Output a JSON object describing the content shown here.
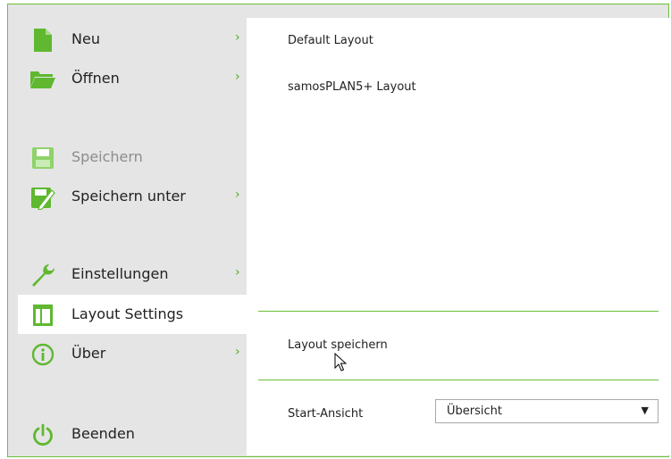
{
  "colors": {
    "accent": "#5fb830",
    "frame_border": "#6bbf3a",
    "menu_bg": "#e5e5e5",
    "disabled_icon": "#8fd36a"
  },
  "menu": [
    {
      "id": "neu",
      "label": "Neu",
      "icon": "new-document-icon",
      "submenu": true
    },
    {
      "id": "oeffnen",
      "label": "Öffnen",
      "icon": "folder-open-icon",
      "submenu": true
    },
    {
      "id": "speichern",
      "label": "Speichern",
      "icon": "save-icon",
      "disabled": true
    },
    {
      "id": "speichern-unter",
      "label": "Speichern unter",
      "icon": "save-as-icon",
      "submenu": true
    },
    {
      "id": "einstellungen",
      "label": "Einstellungen",
      "icon": "wrench-icon",
      "submenu": true
    },
    {
      "id": "layout-settings",
      "label": "Layout Settings",
      "icon": "layout-icon",
      "active": true
    },
    {
      "id": "ueber",
      "label": "Über",
      "icon": "info-icon",
      "submenu": true
    },
    {
      "id": "beenden",
      "label": "Beenden",
      "icon": "power-icon"
    }
  ],
  "chevron": "›",
  "panel": {
    "layouts": [
      "Default Layout",
      "samosPLAN5+ Layout"
    ],
    "save_label": "Layout speichern",
    "start_view_label": "Start-Ansicht",
    "start_view_value": "Übersicht",
    "dropdown_arrow": "▼"
  }
}
